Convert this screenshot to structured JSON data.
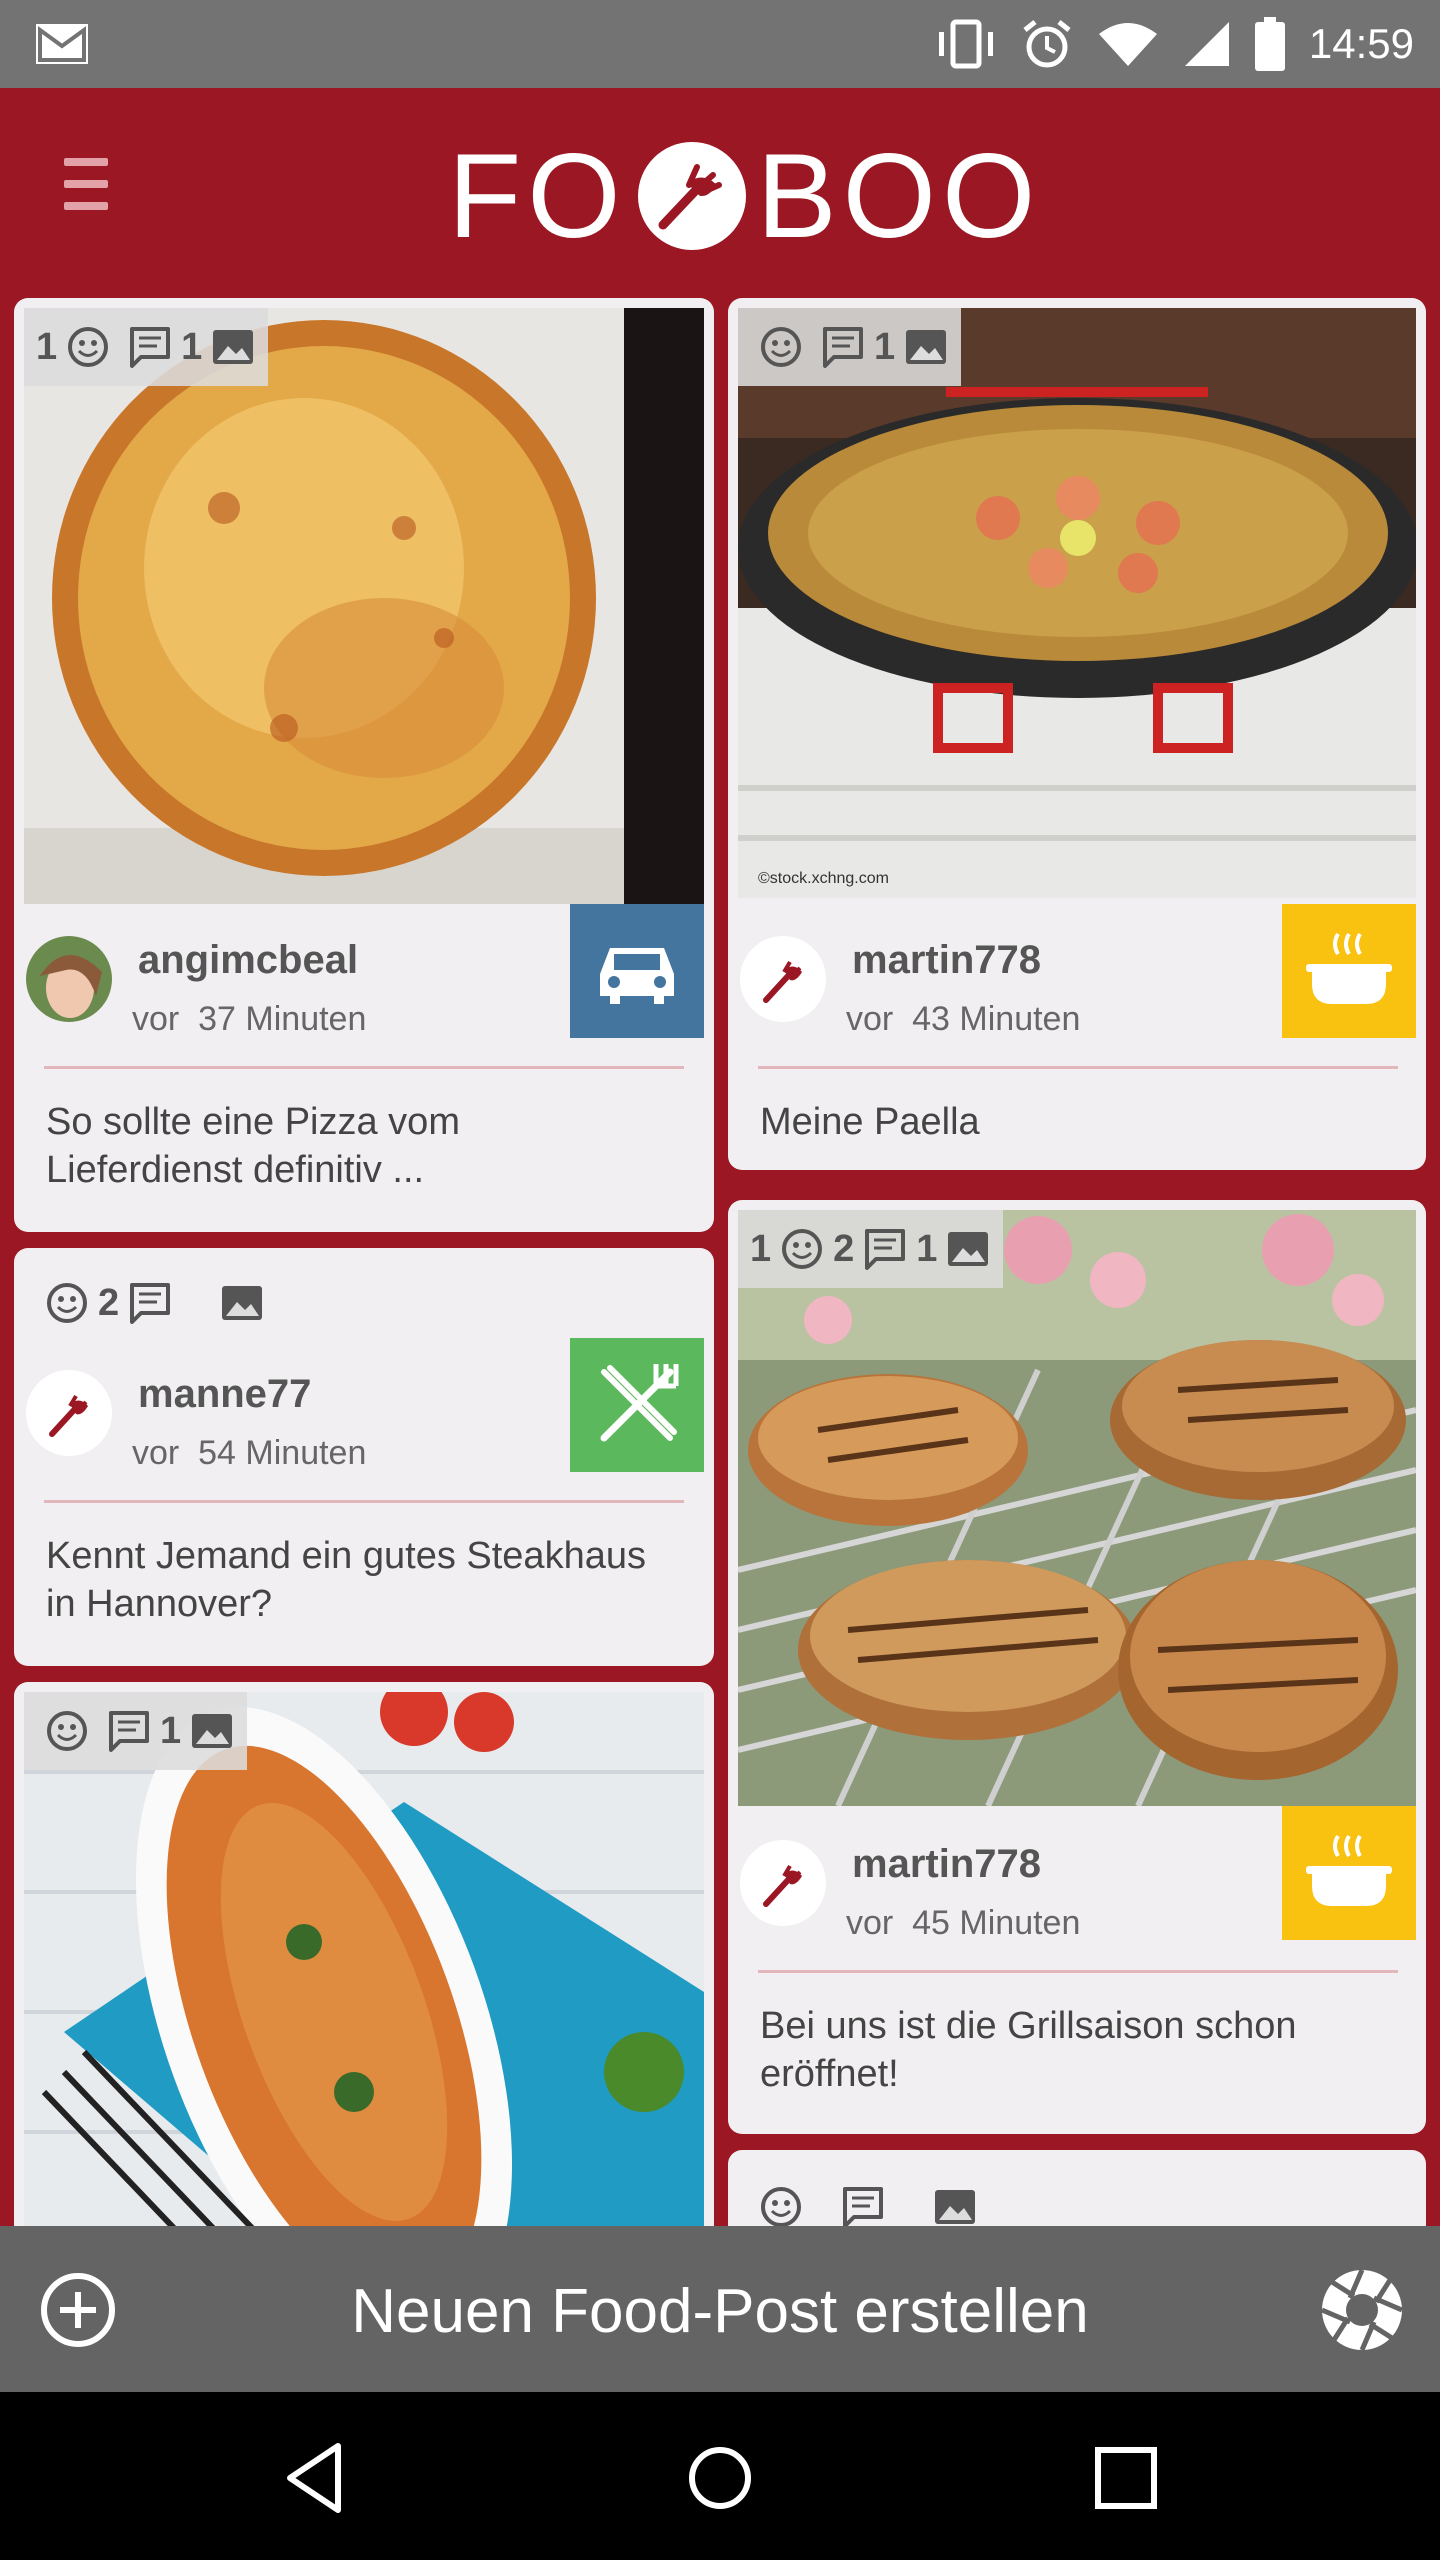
{
  "status_bar": {
    "time": "14:59",
    "icons": [
      "gmail-icon",
      "vibrate-icon",
      "alarm-icon",
      "wifi-icon",
      "signal-icon",
      "battery-icon"
    ]
  },
  "app_bar": {
    "logo_left": "FO",
    "logo_right": "BOO",
    "menu_icon": "hamburger-menu-icon"
  },
  "colors": {
    "brand": "#9b1724",
    "card": "#f1eff1",
    "badge_car": "#43759f",
    "badge_cook": "#f9c110",
    "badge_restaurant": "#5cb85c"
  },
  "posts": [
    {
      "username": "angimcbeal",
      "time_prefix": "vor",
      "time": "37 Minuten",
      "text": "So sollte eine Pizza vom Lieferdienst definitiv ...",
      "likes": "1",
      "comments": "",
      "images": "1",
      "category_icon": "car-icon"
    },
    {
      "username": "martin778",
      "time_prefix": "vor",
      "time": "43 Minuten",
      "text": "Meine Paella",
      "likes": "",
      "comments": "",
      "images": "1",
      "category_icon": "cooking-pot-icon"
    },
    {
      "username": "manne77",
      "time_prefix": "vor",
      "time": "54 Minuten",
      "text": "Kennt Jemand ein gutes Steakhaus in Hannover?",
      "likes": "",
      "comments": "2",
      "images": "",
      "category_icon": "fork-knife-icon"
    },
    {
      "username": "martin778",
      "time_prefix": "vor",
      "time": "45 Minuten",
      "text": "Bei uns ist die Grillsaison schon eröffnet!",
      "likes": "1",
      "comments": "2",
      "images": "1",
      "category_icon": "cooking-pot-icon"
    },
    {
      "likes": "",
      "comments": "",
      "images": "1"
    },
    {
      "likes": "",
      "comments": "",
      "images": ""
    }
  ],
  "bottom_bar": {
    "create_label": "Neuen Food-Post erstellen",
    "add_icon": "add-circle-icon",
    "camera_icon": "camera-shutter-icon"
  },
  "nav_bar": {
    "icons": [
      "back-icon",
      "home-icon",
      "recents-icon"
    ]
  }
}
